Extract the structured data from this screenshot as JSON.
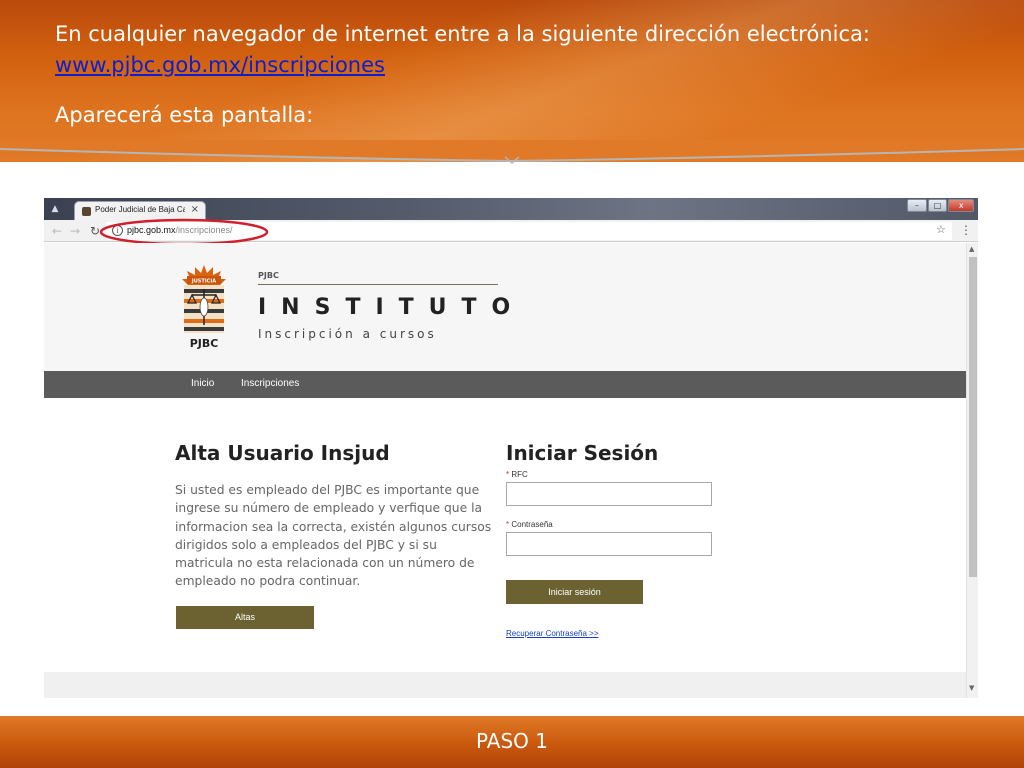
{
  "slide": {
    "header_line1": "En cualquier navegador de internet entre a la siguiente dirección electrónica:",
    "header_link": "www.pjbc.gob.mx/inscripciones",
    "header_line3": "Aparecerá esta pantalla:",
    "footer_label": "PASO 1",
    "colors": {
      "header_orange": "#d2610f",
      "footer_orange": "#c9580d",
      "link_blue": "#0b1fcf"
    }
  },
  "browser": {
    "tab_title": "Poder Judicial de Baja Ca",
    "tab_close": "×",
    "url_host": "pjbc.gob.mx",
    "url_path": "/inscripciones/",
    "window_controls": {
      "minimize": "–",
      "maximize": "□",
      "close": "x"
    },
    "icons": [
      "back-arrow-icon",
      "forward-arrow-icon",
      "reload-icon",
      "info-icon",
      "star-icon",
      "menu-icon"
    ],
    "highlight_color": "#d11f2b"
  },
  "site": {
    "brand_small": "PJBC",
    "brand_title": "INSTITUTO",
    "brand_subtitle": "Inscripción a cursos",
    "logo": {
      "banner": "JUSTICIA",
      "caption": "PJBC"
    },
    "nav": {
      "inicio": "Inicio",
      "inscripciones": "Inscripciones"
    },
    "nav_color": "#5b5b5b",
    "accent_color": "#6c6231"
  },
  "signup": {
    "title": "Alta Usuario Insjud",
    "description": "Si usted es empleado del PJBC es importante que ingrese su número de empleado y verfique que la informacion sea la correcta, existén algunos cursos dirigidos solo a empleados del PJBC y si su matricula no esta relacionada con un número de empleado no podra continuar.",
    "button": "Altas"
  },
  "login": {
    "title": "Iniciar Sesión",
    "required_mark": "*",
    "rfc_label": "RFC",
    "rfc_value": "",
    "password_label": "Contraseña",
    "password_value": "",
    "button": "Iniciar sesión",
    "recover_link": "Recuperar Contraseña >>"
  }
}
